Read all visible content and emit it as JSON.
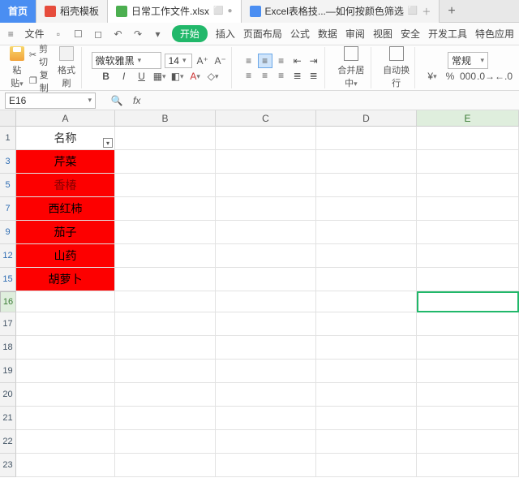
{
  "tabs": {
    "home": "首页",
    "t1": "稻壳模板",
    "t2": "日常工作文件.xlsx",
    "t3": "Excel表格技...—如何按颜色筛选"
  },
  "menu": {
    "file": "文件",
    "start": "开始",
    "insert": "插入",
    "page": "页面布局",
    "formula": "公式",
    "data": "数据",
    "review": "审阅",
    "view": "视图",
    "security": "安全",
    "dev": "开发工具",
    "special": "特色应用"
  },
  "ribbon": {
    "paste": "粘贴",
    "cut": "剪切",
    "copy": "复制",
    "brush": "格式刷",
    "font": "微软雅黑",
    "size": "14",
    "merge": "合并居中",
    "wrap": "自动换行",
    "numfmt": "常规"
  },
  "namebox": "E16",
  "fx": "fx",
  "cols": {
    "A": "A",
    "B": "B",
    "C": "C",
    "D": "D",
    "E": "E"
  },
  "rows_visible": [
    "1",
    "3",
    "5",
    "7",
    "9",
    "12",
    "15",
    "16",
    "17",
    "18",
    "19",
    "20",
    "21",
    "22",
    "23"
  ],
  "cells": {
    "A1": "名称",
    "A3": "芹菜",
    "A5": "香椿",
    "A7": "西红柿",
    "A9": "茄子",
    "A12": "山药",
    "A15": "胡萝卜"
  },
  "active_cell": "E16"
}
